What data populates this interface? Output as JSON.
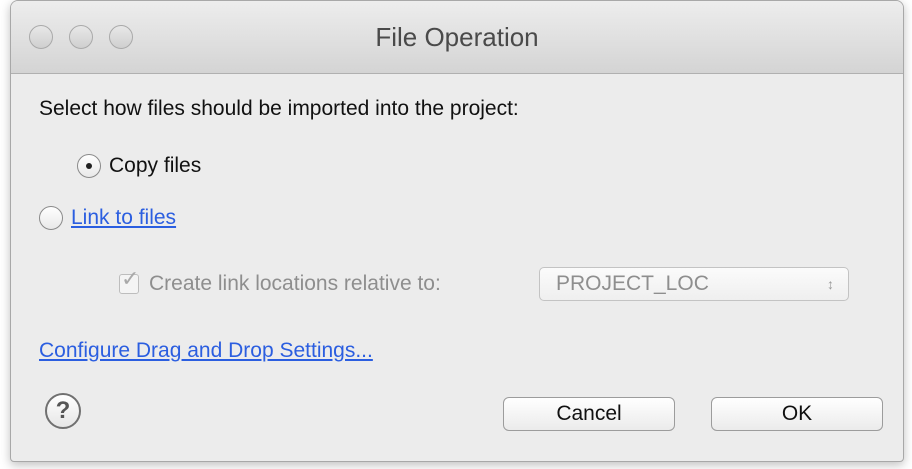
{
  "window": {
    "title": "File Operation"
  },
  "traffic_lights": [
    "close",
    "minimize",
    "zoom"
  ],
  "prompt": "Select how files should be imported into the project:",
  "options": {
    "copy_label": "Copy files",
    "copy_selected": true,
    "link_label": "Link to files",
    "link_selected": false
  },
  "relative": {
    "checkbox_label": "Create link locations relative to:",
    "checked": true,
    "enabled": false,
    "select_value": "PROJECT_LOC",
    "select_arrows": "↕"
  },
  "link_text": "Configure Drag and Drop Settings...",
  "help_symbol": "?",
  "buttons": {
    "cancel": "Cancel",
    "ok": "OK"
  },
  "icons": {
    "help": "help-icon",
    "checkmark": "checkmark-icon"
  },
  "colors": {
    "link": "#2b5ee0",
    "disabled_text": "#8e8e8e"
  }
}
